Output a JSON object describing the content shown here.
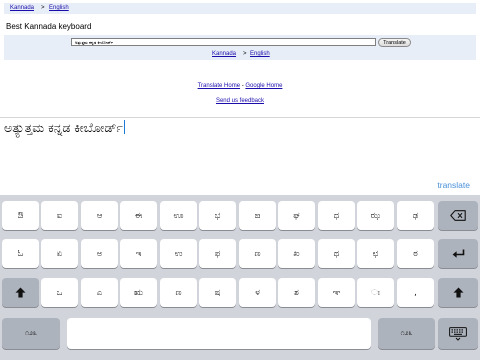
{
  "page": {
    "lang_from": "Kannada",
    "lang_arrow": ">",
    "lang_to": "English",
    "title": "Best Kannada keyboard",
    "source_text": "ಅತ್ಯುತ್ತಮ ಕನ್ನಡ ಕೀಬೋರ್ಡ್",
    "translate_button": "Translate",
    "translate_home": "Translate Home",
    "separator": " - ",
    "google_home": "Google Home",
    "feedback": "Send us feedback"
  },
  "editor": {
    "text": "ಅತ್ಯುತ್ತಮ ಕನ್ನಡ ಕೀಬೋರ್ಡ್",
    "translate_link": "translate"
  },
  "keyboard": {
    "row1": [
      "ಔ",
      "ಐ",
      "ಆ",
      "ಈ",
      "ಊ",
      "ಭ",
      "ಙ",
      "ಘ",
      "ಧ",
      "ಝ",
      "ಢ"
    ],
    "row2": [
      "ಓ",
      "ಏ",
      "ಅ",
      "ಇ",
      "ಉ",
      "ಫ",
      "ಣ",
      "ಖ",
      "ಥ",
      "ಛ",
      "ಠ"
    ],
    "row3": [
      "ಒ",
      "ಎ",
      "ಋ",
      "ಣ",
      "ಷ",
      "ಳ",
      "ಶ",
      "ಞ",
      "ಃ",
      ","
    ],
    "numbers_key": "೧೨೩",
    "icons": {
      "backspace": "backspace-icon",
      "enter": "return-icon",
      "shift": "shift-icon",
      "hide": "keyboard-hide-icon"
    }
  }
}
